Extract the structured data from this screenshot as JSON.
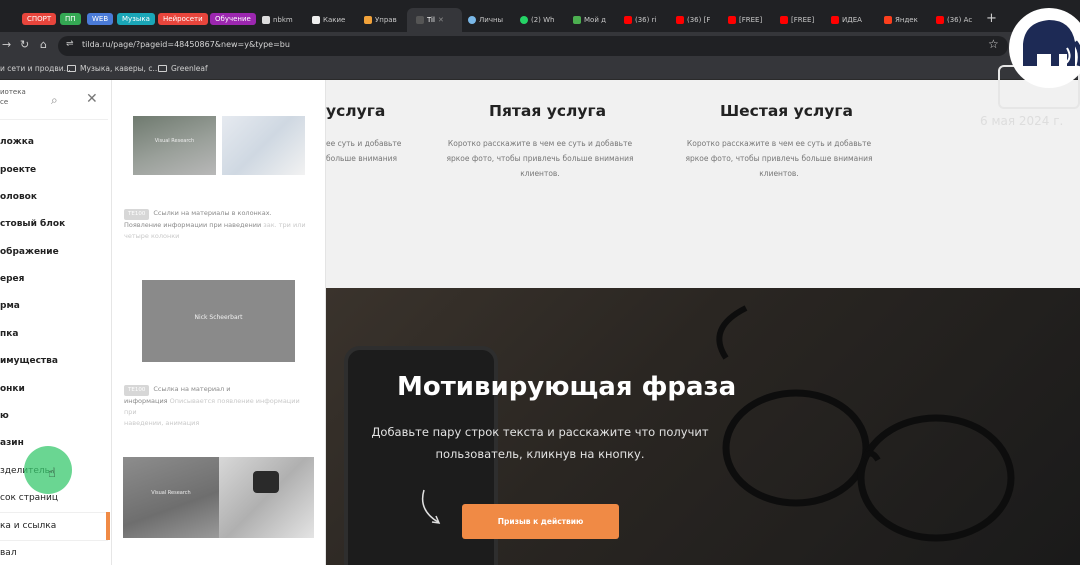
{
  "browser": {
    "bookmark_chips": [
      {
        "label": "СПОРТ",
        "color": "#e8453c"
      },
      {
        "label": "ПП",
        "color": "#34a853"
      },
      {
        "label": "WEB",
        "color": "#4a7bd8"
      },
      {
        "label": "Музыка",
        "color": "#1aa6b7"
      },
      {
        "label": "Нейросети",
        "color": "#e8453c"
      },
      {
        "label": "Обучение",
        "color": "#9c27b0"
      }
    ],
    "tabs": [
      "nbkm",
      "Какие",
      "Управ",
      "Til",
      "Личны",
      "(2) Wh",
      "Мой д",
      "(36) ri",
      "(36) [F",
      "[FREE]",
      "[FREE]",
      "ИДЕА",
      "Яндек",
      "(36) Ас"
    ],
    "url": "tilda.ru/page/?pageid=48450867&new=y&type=bu",
    "bookmarks_bar": [
      "и сети и продви...",
      "Музыка, каверы, с...",
      "Greenleaf"
    ]
  },
  "library": {
    "title_line1": "иотека",
    "title_line2": "се",
    "menu_items": [
      "ложка",
      "роекте",
      "оловок",
      "стовый блок",
      "ображение",
      "ерея",
      "рма",
      "пка",
      "имущества",
      "онки",
      "ю",
      "азин",
      "зделитель",
      "сок страниц",
      "ка и ссылка",
      "вал"
    ]
  },
  "panel": {
    "thumb1_label": "Visual Research",
    "thumb2_label": "Nick Scheerbart",
    "thumb3_label": "Visual Research",
    "cap1_badge": "TE100",
    "cap1_line1": "Ссылки на материалы в колонках.",
    "cap1_line2": "Появление информации при наведении",
    "cap1_line2_faded": "зак. три или",
    "cap1_line3_faded": "четыре колонки",
    "cap2_badge": "TE100",
    "cap2_line1": "Ссылка на материал и",
    "cap2_line2": "информация",
    "cap2_line2_faded": "Описывается появление информации при",
    "cap2_line3_faded": "наведении, анимация"
  },
  "page": {
    "service_5_title": "Пятая услуга",
    "service_6_title": "Шестая услуга",
    "service_4_title_partial": "услуга",
    "service_text_line1": "Коротко расскажите в чем ее суть и добавьте",
    "service_text_line2": "яркое фото, чтобы привлечь больше внимания",
    "service_text_line3": "клиентов.",
    "service_4_text_line1": "ее суть и добавьте",
    "service_4_text_line2": "больше внимания",
    "date": "6 мая 2024 г.",
    "hero_title": "Мотивирующая фраза",
    "hero_text": "Добавьте пару строк текста и расскажите что получит пользователь, кликнув на кнопку.",
    "cta_label": "Призыв к действию"
  }
}
